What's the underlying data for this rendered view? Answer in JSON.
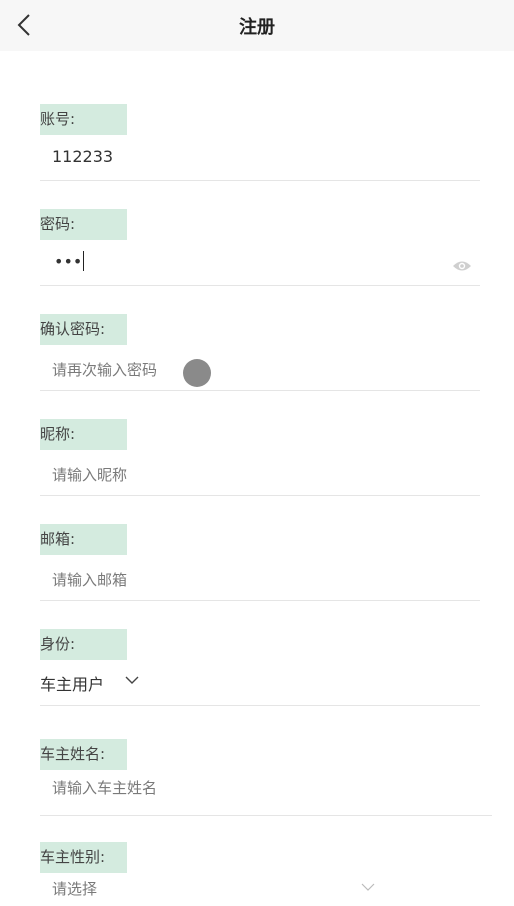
{
  "header": {
    "title": "注册",
    "back_icon": "chevron-left-icon"
  },
  "form": {
    "account": {
      "label": "账号:",
      "value": "112233"
    },
    "password": {
      "label": "密码:",
      "value": "•••",
      "toggle_icon": "eye-icon"
    },
    "confirm_password": {
      "label": "确认密码:",
      "placeholder": "请再次输入密码"
    },
    "nickname": {
      "label": "昵称:",
      "placeholder": "请输入昵称"
    },
    "email": {
      "label": "邮箱:",
      "placeholder": "请输入邮箱"
    },
    "identity": {
      "label": "身份:",
      "value": "车主用户",
      "icon": "chevron-down-icon"
    },
    "owner_name": {
      "label": "车主姓名:",
      "placeholder": "请输入车主姓名"
    },
    "owner_gender": {
      "label": "车主性别:",
      "placeholder": "请选择",
      "icon": "chevron-down-icon"
    }
  },
  "colors": {
    "label_bg": "#d4ebdf",
    "navbar_bg": "#f7f7f7",
    "divider": "#e5e5e5"
  }
}
